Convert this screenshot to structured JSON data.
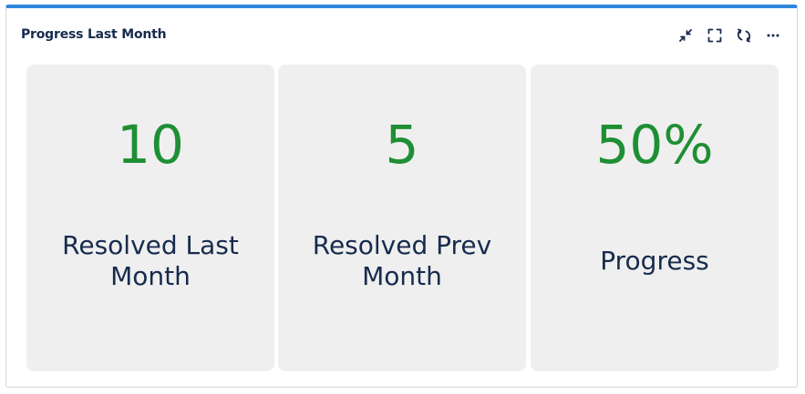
{
  "widget": {
    "title": "Progress Last Month",
    "accent_color": "#2f86dc",
    "tools": [
      {
        "name": "collapse-icon"
      },
      {
        "name": "fullscreen-icon"
      },
      {
        "name": "refresh-icon"
      },
      {
        "name": "more-icon"
      }
    ]
  },
  "cards": [
    {
      "value": "10",
      "label": "Resolved Last Month"
    },
    {
      "value": "5",
      "label": "Resolved Prev Month"
    },
    {
      "value": "50%",
      "label": "Progress"
    }
  ],
  "colors": {
    "value_text": "#1e8f34",
    "label_text": "#172b4d",
    "card_bg": "#efefef"
  }
}
